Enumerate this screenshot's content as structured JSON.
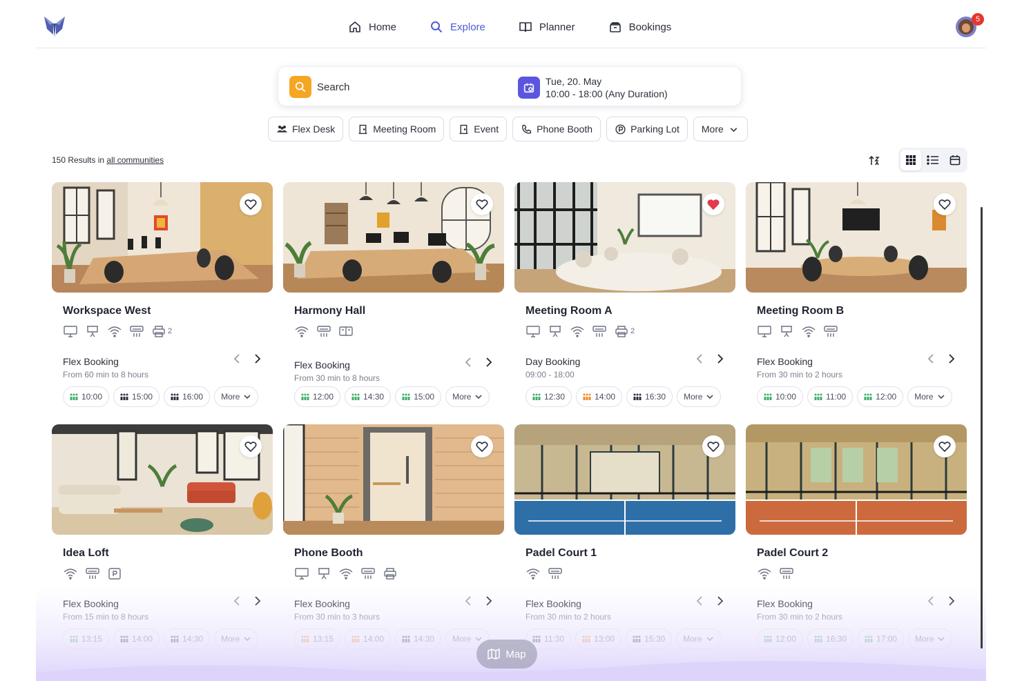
{
  "nav": {
    "items": [
      {
        "label": "Home",
        "icon": "home-icon",
        "active": false
      },
      {
        "label": "Explore",
        "icon": "search-icon",
        "active": true
      },
      {
        "label": "Planner",
        "icon": "book-icon",
        "active": false
      },
      {
        "label": "Bookings",
        "icon": "archive-icon",
        "active": false
      }
    ],
    "notification_count": "5"
  },
  "search": {
    "label": "Search",
    "date_line1": "Tue, 20. May",
    "date_line2": "10:00 - 18:00 (Any Duration)"
  },
  "filters": [
    {
      "label": "Flex Desk",
      "icon": "people-icon"
    },
    {
      "label": "Meeting Room",
      "icon": "door-icon"
    },
    {
      "label": "Event",
      "icon": "door-icon"
    },
    {
      "label": "Phone Booth",
      "icon": "phone-icon"
    },
    {
      "label": "Parking Lot",
      "icon": "parking-icon"
    },
    {
      "label": "More",
      "icon": "chevron-down-icon"
    }
  ],
  "results": {
    "prefix": "150 Results in",
    "link": "all communities"
  },
  "cards": [
    {
      "title": "Workspace West",
      "favorite": false,
      "amenities": [
        "monitor",
        "projector",
        "wifi",
        "ac",
        "printer"
      ],
      "count": "2",
      "booking_type": "Flex Booking",
      "booking_range": "From 60 min to 8 hours",
      "slots": [
        {
          "time": "10:00",
          "level": "low"
        },
        {
          "time": "15:00",
          "level": "full"
        },
        {
          "time": "16:00",
          "level": "full"
        }
      ],
      "more": "More"
    },
    {
      "title": "Harmony Hall",
      "favorite": false,
      "amenities": [
        "wifi",
        "ac",
        "board"
      ],
      "count": "",
      "booking_type": "Flex Booking",
      "booking_range": "From 30 min to 8 hours",
      "slots": [
        {
          "time": "12:00",
          "level": "low"
        },
        {
          "time": "14:30",
          "level": "low"
        },
        {
          "time": "15:00",
          "level": "low"
        }
      ],
      "more": "More"
    },
    {
      "title": "Meeting Room A",
      "favorite": true,
      "amenities": [
        "monitor",
        "projector",
        "wifi",
        "ac",
        "printer"
      ],
      "count": "2",
      "booking_type": "Day Booking",
      "booking_range": "09:00 - 18:00",
      "slots": [
        {
          "time": "12:30",
          "level": "low"
        },
        {
          "time": "14:00",
          "level": "mid"
        },
        {
          "time": "16:30",
          "level": "full"
        }
      ],
      "more": "More"
    },
    {
      "title": "Meeting Room B",
      "favorite": false,
      "amenities": [
        "monitor",
        "projector",
        "wifi",
        "ac"
      ],
      "count": "",
      "booking_type": "Flex Booking",
      "booking_range": "From 30 min to 2 hours",
      "slots": [
        {
          "time": "10:00",
          "level": "low"
        },
        {
          "time": "11:00",
          "level": "low"
        },
        {
          "time": "12:00",
          "level": "low"
        }
      ],
      "more": "More"
    },
    {
      "title": "Idea Loft",
      "favorite": false,
      "amenities": [
        "wifi",
        "ac",
        "parking"
      ],
      "count": "",
      "booking_type": "Flex Booking",
      "booking_range": "From 15 min to 8 hours",
      "slots": [
        {
          "time": "13:15",
          "level": "low"
        },
        {
          "time": "14:00",
          "level": "full"
        },
        {
          "time": "14:30",
          "level": "full"
        }
      ],
      "more": "More"
    },
    {
      "title": "Phone Booth",
      "favorite": false,
      "amenities": [
        "monitor",
        "projector",
        "wifi",
        "ac",
        "printer"
      ],
      "count": "",
      "booking_type": "Flex Booking",
      "booking_range": "From 30 min to 3 hours",
      "slots": [
        {
          "time": "13:15",
          "level": "mid"
        },
        {
          "time": "14:00",
          "level": "mid"
        },
        {
          "time": "14:30",
          "level": "full"
        }
      ],
      "more": "More"
    },
    {
      "title": "Padel Court 1",
      "favorite": false,
      "amenities": [
        "wifi",
        "ac"
      ],
      "count": "",
      "booking_type": "Flex Booking",
      "booking_range": "From 30 min to 2 hours",
      "slots": [
        {
          "time": "11:30",
          "level": "full"
        },
        {
          "time": "13:00",
          "level": "mid"
        },
        {
          "time": "15:30",
          "level": "full"
        }
      ],
      "more": "More"
    },
    {
      "title": "Padel Court 2",
      "favorite": false,
      "amenities": [
        "wifi",
        "ac"
      ],
      "count": "",
      "booking_type": "Flex Booking",
      "booking_range": "From 30 min to 2 hours",
      "slots": [
        {
          "time": "12:00",
          "level": "low"
        },
        {
          "time": "16:30",
          "level": "low"
        },
        {
          "time": "17:00",
          "level": "low"
        }
      ],
      "more": "More"
    }
  ],
  "map_button": "Map",
  "colors": {
    "accent": "#4d5bd6",
    "search_icon_bg": "#f5a623",
    "calendar_icon_bg": "#5b55e0",
    "favorite_active": "#e23b4a",
    "slot_low": "#3fae6b",
    "slot_mid": "#f08a24",
    "slot_full": "#2a2f3a"
  }
}
